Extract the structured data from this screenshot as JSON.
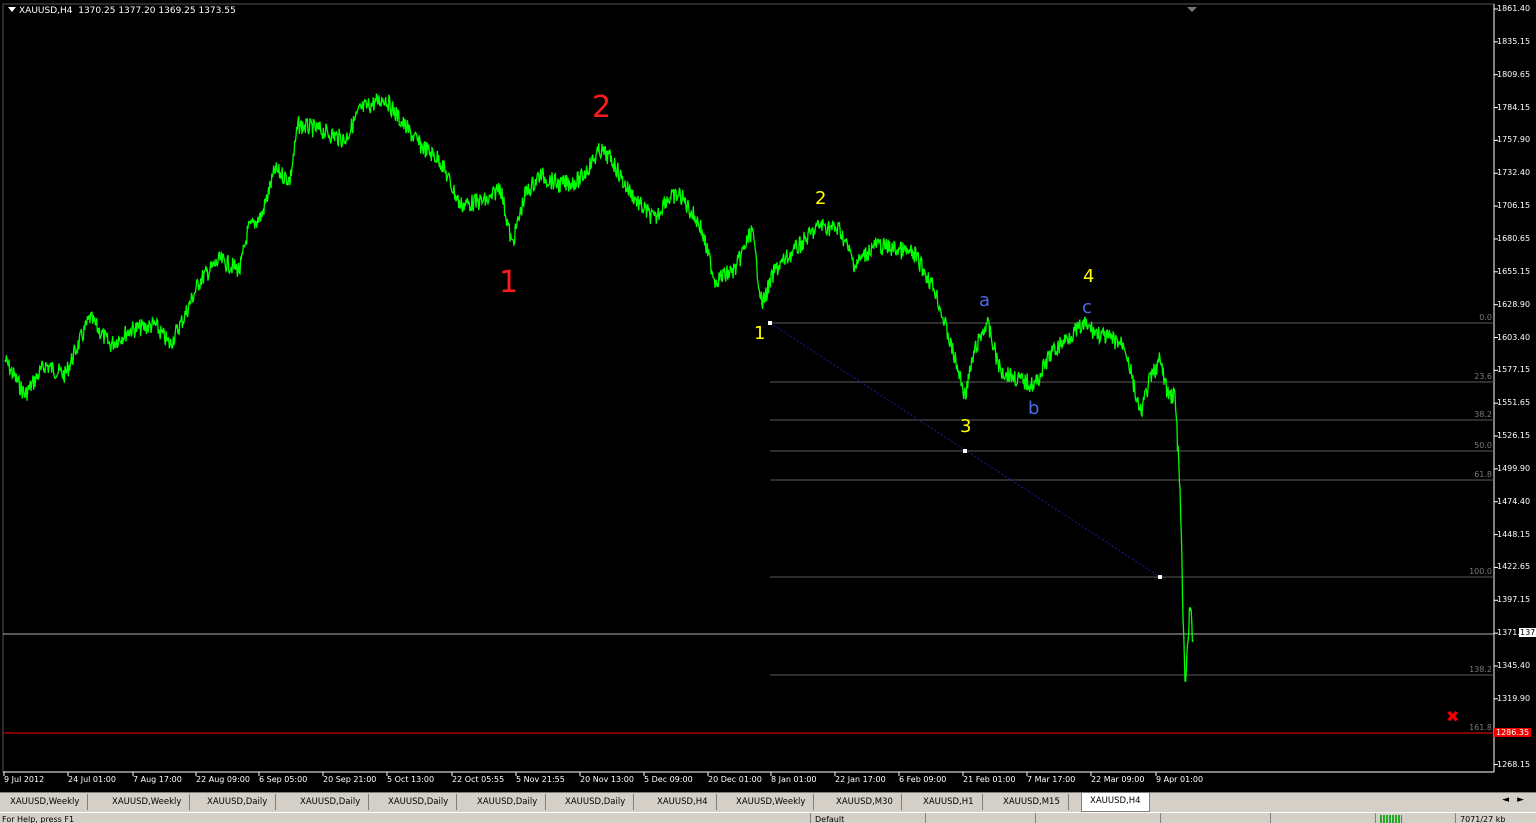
{
  "header": {
    "symbol": "XAUUSD,H4",
    "ohlc": "1370.25 1377.20 1369.25 1373.55"
  },
  "colors": {
    "price_line": "#00ff00",
    "background": "#000000",
    "fib_line": "#5a5a5a",
    "current_price_line": "#c0c0c0",
    "stop_line": "#ff0000",
    "trend_line": "#000080"
  },
  "y_axis": {
    "ticks": [
      "1861.40",
      "1835.15",
      "1809.65",
      "1784.15",
      "1757.90",
      "1732.40",
      "1706.15",
      "1680.65",
      "1655.15",
      "1628.90",
      "1603.40",
      "1577.15",
      "1551.65",
      "1526.15",
      "1499.90",
      "1474.40",
      "1448.15",
      "1422.65",
      "1397.15",
      "1371.65",
      "1345.40",
      "1319.90",
      "1294.40",
      "1268.15"
    ]
  },
  "x_axis": {
    "ticks": [
      "9 Jul 2012",
      "24 Jul 01:00",
      "7 Aug 17:00",
      "22 Aug 09:00",
      "6 Sep 05:00",
      "20 Sep 21:00",
      "5 Oct 13:00",
      "22 Oct 05:55",
      "5 Nov 21:55",
      "20 Nov 13:00",
      "5 Dec 09:00",
      "20 Dec 01:00",
      "8 Jan 01:00",
      "22 Jan 17:00",
      "6 Feb 09:00",
      "21 Feb 01:00",
      "7 Mar 17:00",
      "22 Mar 09:00",
      "9 Apr 01:00"
    ]
  },
  "fib_levels": [
    "0.0",
    "23.6",
    "38.2",
    "50.0",
    "61.8",
    "100.0",
    "138.2",
    "161.8"
  ],
  "wave_labels": {
    "major": [
      "1",
      "2"
    ],
    "minor": [
      "1",
      "2",
      "3",
      "4"
    ],
    "corrective": [
      "a",
      "b",
      "c"
    ]
  },
  "price_box": "1373.55",
  "stop_box": "1286.35",
  "close_mark": "✖",
  "chart_data": {
    "type": "line",
    "title": "XAUUSD,H4",
    "ylim": [
      1260,
      1866
    ],
    "x": [
      "9 Jul 2012",
      "24 Jul 01:00",
      "7 Aug 17:00",
      "22 Aug 09:00",
      "6 Sep 05:00",
      "20 Sep 21:00",
      "5 Oct 13:00",
      "22 Oct 05:55",
      "5 Nov 21:55",
      "20 Nov 13:00",
      "5 Dec 09:00",
      "20 Dec 01:00",
      "8 Jan 01:00",
      "22 Jan 17:00",
      "6 Feb 09:00",
      "21 Feb 01:00",
      "7 Mar 17:00",
      "22 Mar 09:00",
      "9 Apr 01:00"
    ],
    "series": [
      {
        "values": [
          1590,
          1580,
          1610,
          1625,
          1720,
          1775,
          1790,
          1715,
          1740,
          1750,
          1700,
          1650,
          1665,
          1690,
          1640,
          1590,
          1580,
          1620,
          1385
        ]
      }
    ],
    "current_price": 1373.55
  },
  "tabs": [
    "XAUUSD,Weekly",
    "XAUUSD,Weekly",
    "XAUUSD,Daily",
    "XAUUSD,Daily",
    "XAUUSD,Daily",
    "XAUUSD,Daily",
    "XAUUSD,Daily",
    "XAUUSD,H4",
    "XAUUSD,Weekly",
    "XAUUSD,M30",
    "XAUUSD,H1",
    "XAUUSD,M15",
    "XAUUSD,H4"
  ],
  "status": {
    "help": "For Help, press F1",
    "profile": "Default",
    "traffic": "7071/27 kb"
  }
}
